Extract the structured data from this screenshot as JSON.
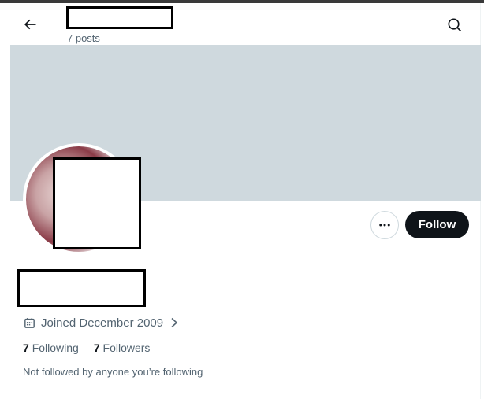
{
  "header": {
    "title": "",
    "post_count": "7 posts",
    "back_icon": "arrow-left-icon",
    "search_icon": "search-icon"
  },
  "profile": {
    "display_name": "",
    "joined": "Joined December 2009",
    "following_count": "7",
    "following_label": "Following",
    "followers_count": "7",
    "followers_label": "Followers",
    "not_followed_text": "Not followed by anyone you’re following"
  },
  "actions": {
    "follow_label": "Follow",
    "more_icon": "ellipsis-icon"
  },
  "colors": {
    "banner": "#cfd9de",
    "follow_button": "#0f1419",
    "secondary_text": "#536471"
  }
}
